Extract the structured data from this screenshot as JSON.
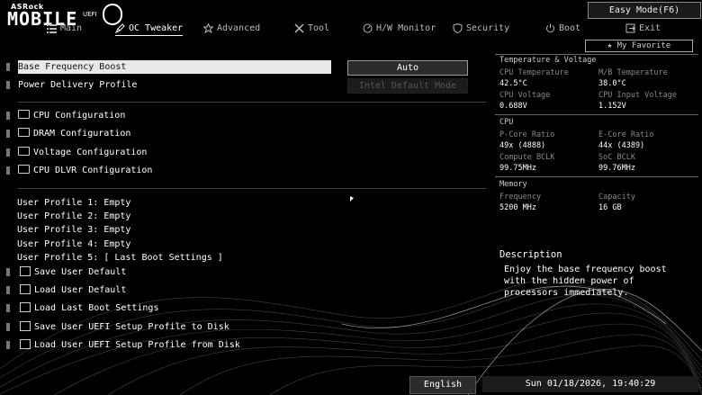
{
  "brand": {
    "maker": "ASRock",
    "motto": "MOBILE",
    "uefi": "UEFI"
  },
  "easy_mode": "Easy Mode(F6)",
  "my_favorite": "My Favorite",
  "tabs": [
    {
      "label": "Main",
      "icon": "list-icon"
    },
    {
      "label": "OC Tweaker",
      "icon": "rocket-icon"
    },
    {
      "label": "Advanced",
      "icon": "star-icon"
    },
    {
      "label": "Tool",
      "icon": "tools-icon"
    },
    {
      "label": "H/W Monitor",
      "icon": "monitor-icon"
    },
    {
      "label": "Security",
      "icon": "shield-icon"
    },
    {
      "label": "Boot",
      "icon": "power-icon"
    },
    {
      "label": "Exit",
      "icon": "exit-icon"
    }
  ],
  "settings": {
    "base_frequency_boost": {
      "label": "Base Frequency Boost",
      "value": "Auto"
    },
    "power_delivery_profile": {
      "label": "Power Delivery Profile",
      "value": "Intel Default Mode"
    }
  },
  "submenus": [
    "CPU Configuration",
    "DRAM Configuration",
    "Voltage Configuration",
    "CPU DLVR Configuration"
  ],
  "profiles": [
    "User Profile 1: Empty",
    "User Profile 2: Empty",
    "User Profile 3: Empty",
    "User Profile 4: Empty",
    "User Profile 5: [ Last Boot Settings ]"
  ],
  "actions": [
    "Save User Default",
    "Load User Default",
    "Load Last Boot Settings",
    "Save User UEFI Setup Profile to Disk",
    "Load User UEFI Setup Profile from Disk"
  ],
  "monitor": {
    "section_title": "Temperature & Voltage",
    "cpu_temp_label": "CPU Temperature",
    "cpu_temp": "42.5°C",
    "mb_temp_label": "M/B Temperature",
    "mb_temp": "38.0°C",
    "cpu_voltage_label": "CPU Voltage",
    "cpu_voltage": "0.688V",
    "cpu_input_voltage_label": "CPU Input Voltage",
    "cpu_input_voltage": "1.152V",
    "cpu_title": "CPU",
    "pcore_label": "P-Core Ratio",
    "pcore": "49x (4888)",
    "ecore_label": "E-Core Ratio",
    "ecore": "44x (4389)",
    "compute_bclk_label": "Compute BCLK",
    "compute_bclk": "99.75MHz",
    "soc_bclk_label": "SoC BCLK",
    "soc_bclk": "99.76MHz",
    "memory_title": "Memory",
    "freq_label": "Frequency",
    "freq": "5200 MHz",
    "capacity_label": "Capacity",
    "capacity": "16 GB"
  },
  "description": {
    "title": "Description",
    "text": "Enjoy the base frequency boost with the hidden power of processors immediately."
  },
  "footer": {
    "language": "English",
    "datetime": "Sun 01/18/2026, 19:40:29"
  }
}
